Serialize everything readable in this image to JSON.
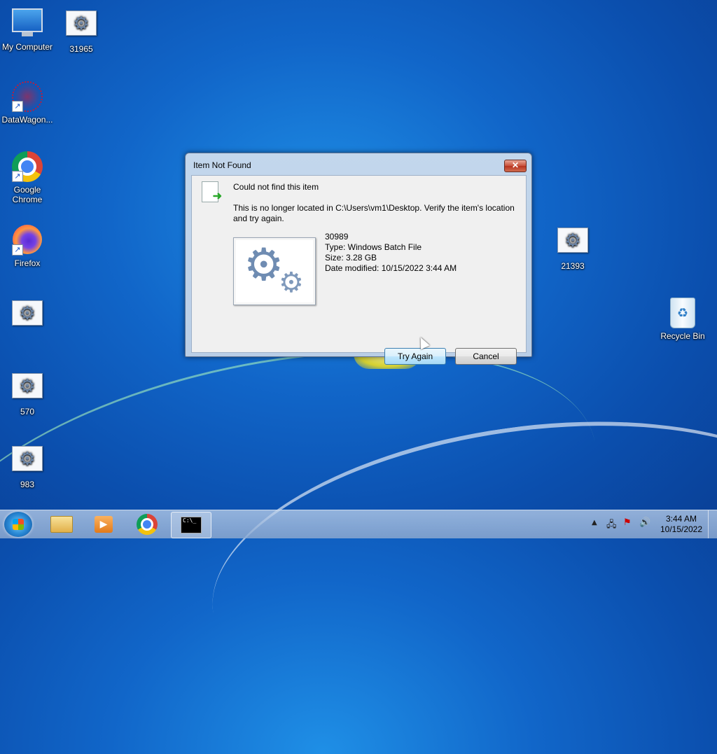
{
  "desktop": {
    "icons": [
      {
        "label": "My Computer",
        "icon": "computer-icon"
      },
      {
        "label": "31965",
        "icon": "batch-file-icon"
      },
      {
        "label": "DataWagon...",
        "icon": "datawagon-icon"
      },
      {
        "label": "Google\nChrome",
        "icon": "chrome-icon"
      },
      {
        "label": "Firefox",
        "icon": "firefox-icon"
      },
      {
        "label": "",
        "icon": "batch-file-icon"
      },
      {
        "label": "570",
        "icon": "batch-file-icon"
      },
      {
        "label": "983",
        "icon": "batch-file-icon"
      },
      {
        "label": "21393",
        "icon": "batch-file-icon"
      },
      {
        "label": "Recycle Bin",
        "icon": "recycle-bin-icon"
      }
    ]
  },
  "dialog": {
    "title": "Item Not Found",
    "close_label": "✕",
    "heading": "Could not find this item",
    "message": "This is no longer located in C:\\Users\\vm1\\Desktop. Verify the item's location and try again.",
    "file": {
      "name": "30989",
      "type": "Type: Windows Batch File",
      "size": "Size: 3.28 GB",
      "modified": "Date modified: 10/15/2022 3:44 AM"
    },
    "buttons": {
      "try_again": "Try Again",
      "cancel": "Cancel"
    }
  },
  "taskbar": {
    "pinned": [
      "windows-explorer-icon",
      "media-player-icon",
      "chrome-icon",
      "command-prompt-icon"
    ],
    "cmd_text": "C:\\_",
    "clock": {
      "time": "3:44 AM",
      "date": "10/15/2022"
    }
  }
}
